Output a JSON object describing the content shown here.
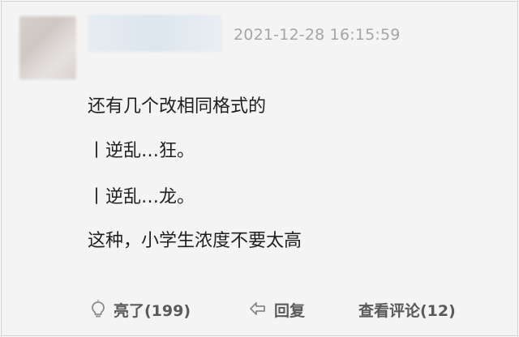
{
  "post": {
    "timestamp": "2021-12-28 16:15:59",
    "lines": [
      "还有几个改相同格式的",
      "丨逆乱…狂。",
      "丨逆乱…龙。",
      "这种，小学生浓度不要太高"
    ]
  },
  "actions": {
    "like_label": "亮了(199)",
    "reply_label": "回复",
    "view_comments_label": "查看评论(12)"
  },
  "icons": {
    "like": "lightbulb-icon",
    "reply": "reply-arrow-icon"
  }
}
